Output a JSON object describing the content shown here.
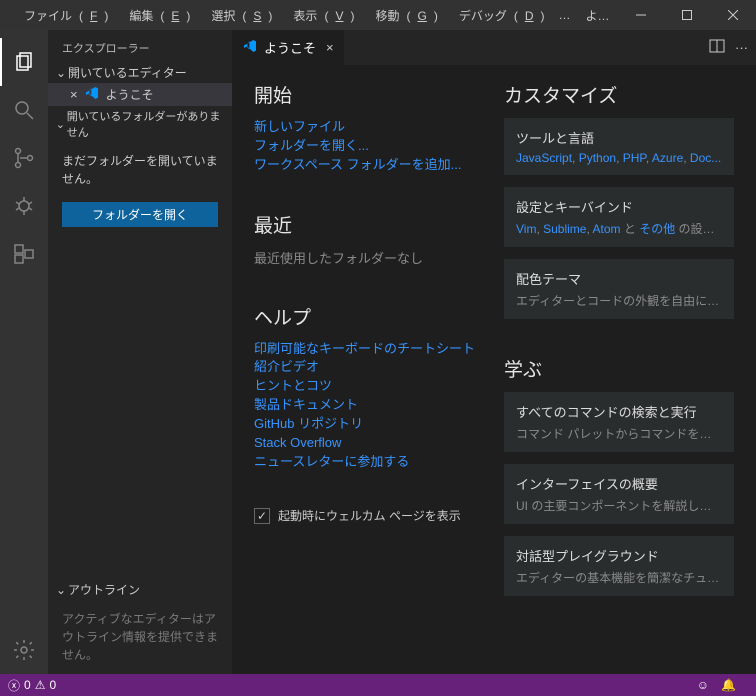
{
  "titlebar": {
    "menu": {
      "file": "ファイル",
      "file_m": "F",
      "edit": "編集",
      "edit_m": "E",
      "selection": "選択",
      "selection_m": "S",
      "view": "表示",
      "view_m": "V",
      "go": "移動",
      "go_m": "G",
      "debug": "デバッグ",
      "debug_m": "D",
      "more": "…"
    },
    "title": "ようこそ - Visual Studi..."
  },
  "sidebar": {
    "title": "エクスプローラー",
    "open_editors_header": "開いているエディター",
    "welcome_tab": "ようこそ",
    "no_folder_header": "開いているフォルダーがありません",
    "no_folder_msg": "まだフォルダーを開いていません。",
    "open_folder_btn": "フォルダーを開く",
    "outline_header": "アウトライン",
    "outline_msg": "アクティブなエディターはアウトライン情報を提供できません。"
  },
  "tab": {
    "label": "ようこそ"
  },
  "welcome": {
    "start": {
      "heading": "開始",
      "new_file": "新しいファイル",
      "open_folder": "フォルダーを開く...",
      "add_workspace": "ワークスペース フォルダーを追加..."
    },
    "recent": {
      "heading": "最近",
      "none": "最近使用したフォルダーなし"
    },
    "help": {
      "heading": "ヘルプ",
      "cheatsheet": "印刷可能なキーボードのチートシート",
      "video": "紹介ビデオ",
      "tips": "ヒントとコツ",
      "docs": "製品ドキュメント",
      "github": "GitHub リポジトリ",
      "so": "Stack Overflow",
      "newsletter": "ニュースレターに参加する"
    },
    "show_on_start": "起動時にウェルカム ページを表示",
    "customize": {
      "heading": "カスタマイズ",
      "tools_title": "ツールと言語",
      "tools_sub_pre": "",
      "tools_js": "JavaScript",
      "tools_py": "Python",
      "tools_php": "PHP",
      "tools_az": "Azure",
      "tools_doc": "Doc...",
      "settings_title": "設定とキーバインド",
      "settings_vim": "Vim",
      "settings_sublime": "Sublime",
      "settings_atom": "Atom",
      "settings_and": " と ",
      "settings_others": "その他",
      "settings_tail": " の設定...",
      "theme_title": "配色テーマ",
      "theme_sub": "エディターとコードの外観を自由に設定し..."
    },
    "learn": {
      "heading": "学ぶ",
      "cmd_title": "すべてのコマンドの検索と実行",
      "cmd_sub": "コマンド パレットからコマンドを検索してす...",
      "ui_title": "インターフェイスの概要",
      "ui_sub": "UI の主要コンポーネントを解説した視覚...",
      "play_title": "対話型プレイグラウンド",
      "play_sub": "エディターの基本機能を簡潔なチュートリ..."
    }
  },
  "statusbar": {
    "errors": "0",
    "warnings": "0"
  }
}
